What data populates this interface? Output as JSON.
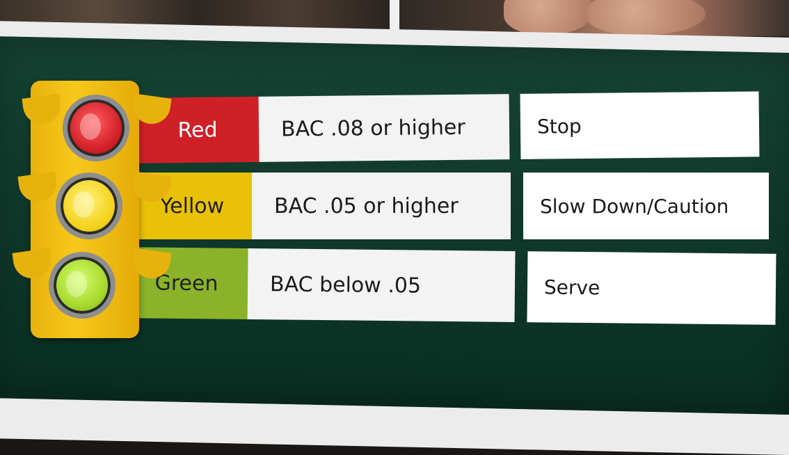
{
  "colors": {
    "board": "#0c3a2b",
    "red": "#cf2027",
    "yellow": "#e9c106",
    "green": "#8ab32a",
    "light_body": "#f3c11a"
  },
  "rows": [
    {
      "label": "Red",
      "bac": "BAC .08 or higher",
      "action": "Stop"
    },
    {
      "label": "Yellow",
      "bac": "BAC .05 or higher",
      "action": "Slow Down/Caution"
    },
    {
      "label": "Green",
      "bac": "BAC below .05",
      "action": "Serve"
    }
  ],
  "icons": {
    "traffic_light": "traffic-light-icon",
    "red_lamp": "red-lamp-icon",
    "yellow_lamp": "yellow-lamp-icon",
    "green_lamp": "green-lamp-icon"
  }
}
